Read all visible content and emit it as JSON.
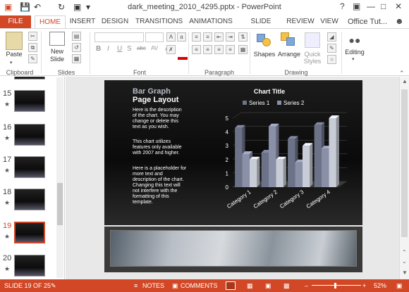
{
  "window": {
    "title": "dark_meeting_2010_4295.pptx - PowerPoint",
    "user": "Office Tut...",
    "help": "?",
    "minimize": "—",
    "restore": "□",
    "close": "✕"
  },
  "tabs": [
    "FILE",
    "HOME",
    "INSERT",
    "DESIGN",
    "TRANSITIONS",
    "ANIMATIONS",
    "SLIDE SHOW",
    "REVIEW",
    "VIEW"
  ],
  "ribbon": {
    "paste": "Paste",
    "new_slide_1": "New",
    "new_slide_2": "Slide",
    "shapes": "Shapes",
    "arrange": "Arrange",
    "quick_styles_1": "Quick",
    "quick_styles_2": "Styles",
    "editing": "Editing",
    "groups": {
      "clipboard": "Clipboard",
      "slides": "Slides",
      "font": "Font",
      "paragraph": "Paragraph",
      "drawing": "Drawing"
    },
    "font_buttons": [
      "B",
      "I",
      "U",
      "S",
      "abc",
      "AV",
      "Aa"
    ]
  },
  "thumbnails": [
    {
      "num": "15",
      "star": "★"
    },
    {
      "num": "16",
      "star": "★"
    },
    {
      "num": "17",
      "star": "★"
    },
    {
      "num": "18",
      "star": "★"
    },
    {
      "num": "19",
      "star": "★"
    },
    {
      "num": "20",
      "star": "★"
    }
  ],
  "slide": {
    "heading1": "Bar Graph",
    "heading2": "Page Layout",
    "para1": [
      "Here is the description",
      "of the chart.  You may",
      "change or delete this",
      "text as you wish."
    ],
    "para2": [
      "This chart utilizes",
      "features only available",
      "with  2007 and higher."
    ],
    "para3": [
      "Here is a placeholder for",
      "more text and",
      "description of the chart.",
      "Changing this text will",
      "not interfere with the",
      "formatting of this",
      "template."
    ]
  },
  "chart_data": {
    "type": "bar",
    "title": "Chart Title",
    "categories": [
      "Category 1",
      "Category 2",
      "Category 3",
      "Category 4"
    ],
    "series": [
      {
        "name": "Series 1",
        "values": [
          4.3,
          2.5,
          3.5,
          4.5
        ],
        "color": "#6c7287"
      },
      {
        "name": "Series 2",
        "values": [
          2.4,
          4.4,
          1.8,
          2.8
        ],
        "color": "#8a90a8"
      },
      {
        "name": "",
        "values": [
          2.0,
          2.0,
          3.0,
          5.0
        ],
        "color": "#c8ccd6"
      }
    ],
    "yticks": [
      "0",
      "1",
      "2",
      "3",
      "4",
      "5"
    ],
    "ylim": [
      0,
      5
    ],
    "legend": "top"
  },
  "status": {
    "slide": "SLIDE 19 OF 25",
    "notes": "NOTES",
    "comments": "COMMENTS",
    "zoom": "52%",
    "zoom_minus": "–",
    "zoom_plus": "+"
  }
}
